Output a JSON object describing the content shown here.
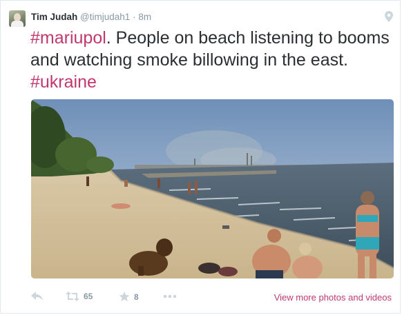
{
  "tweet": {
    "author_name": "Tim Judah",
    "author_handle": "@timjudah1",
    "separator": "·",
    "timestamp": "8m",
    "text": {
      "hashtag1": "#mariupol",
      "body": ". People on beach listening to booms and watching smoke billowing in the east.",
      "hashtag2": "#ukraine"
    }
  },
  "actions": {
    "retweet_count": "65",
    "favorite_count": "8",
    "view_more_label": "View more photos and videos"
  },
  "icons": {
    "location": "location-pin-icon",
    "reply": "reply-icon",
    "retweet": "retweet-icon",
    "favorite": "star-icon",
    "more": "more-dots-icon"
  },
  "colors": {
    "hashtag": "#c1386e",
    "muted": "#8899a6",
    "text": "#292f33"
  }
}
